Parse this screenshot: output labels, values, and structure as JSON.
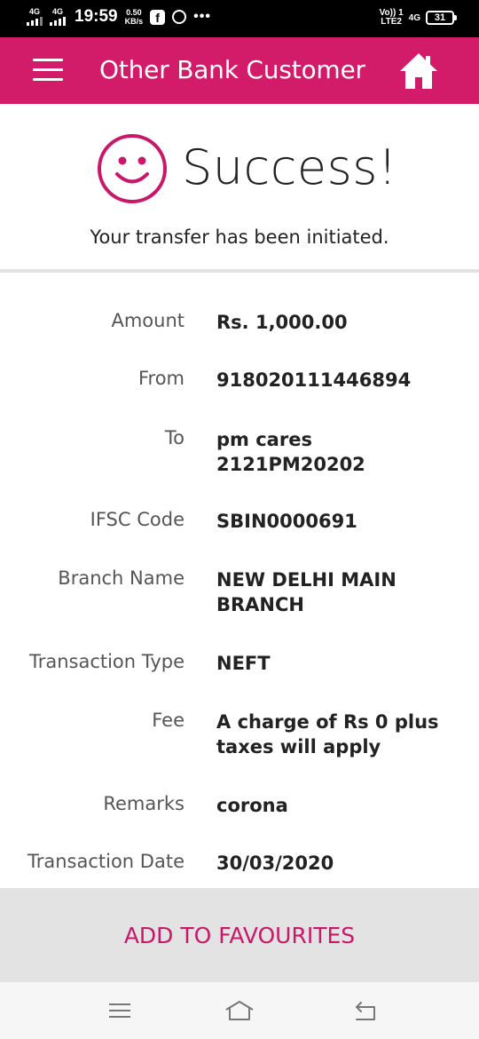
{
  "status_bar": {
    "network1": "4G",
    "network2": "4G",
    "time": "19:59",
    "speed_value": "0.50",
    "speed_unit": "KB/s",
    "volte_line1": "Vo)) 1",
    "volte_line2": "LTE2",
    "network_right": "4G",
    "battery": "31"
  },
  "app_bar": {
    "title": "Other Bank Customer",
    "menu_icon": "hamburger-menu-icon",
    "home_icon": "home-icon",
    "color": "#d21c6a"
  },
  "success": {
    "title": "Success!",
    "message": "Your transfer has been initiated.",
    "icon": "smiley-icon",
    "icon_color": "#c8186a"
  },
  "details": [
    {
      "label": "Amount",
      "value": "Rs. 1,000.00"
    },
    {
      "label": "From",
      "value": "918020111446894"
    },
    {
      "label": "To",
      "value_lines": [
        "pm cares",
        "2121PM20202"
      ]
    },
    {
      "label": "IFSC Code",
      "value": "SBIN0000691"
    },
    {
      "label": "Branch Name",
      "value_lines": [
        "NEW DELHI MAIN",
        "BRANCH"
      ]
    },
    {
      "label": "Transaction Type",
      "value": "NEFT"
    },
    {
      "label": "Fee",
      "value_lines": [
        "A charge of Rs 0 plus",
        "taxes will apply"
      ]
    },
    {
      "label": "Remarks",
      "value": "corona"
    },
    {
      "label": "Transaction Date",
      "value": "30/03/2020"
    }
  ],
  "actions": {
    "add_to_favourites": "ADD TO FAVOURITES",
    "accent_color": "#c8186a"
  },
  "nav_bar": {
    "recents_icon": "recents-icon",
    "home_icon": "nav-home-icon",
    "back_icon": "back-icon"
  }
}
